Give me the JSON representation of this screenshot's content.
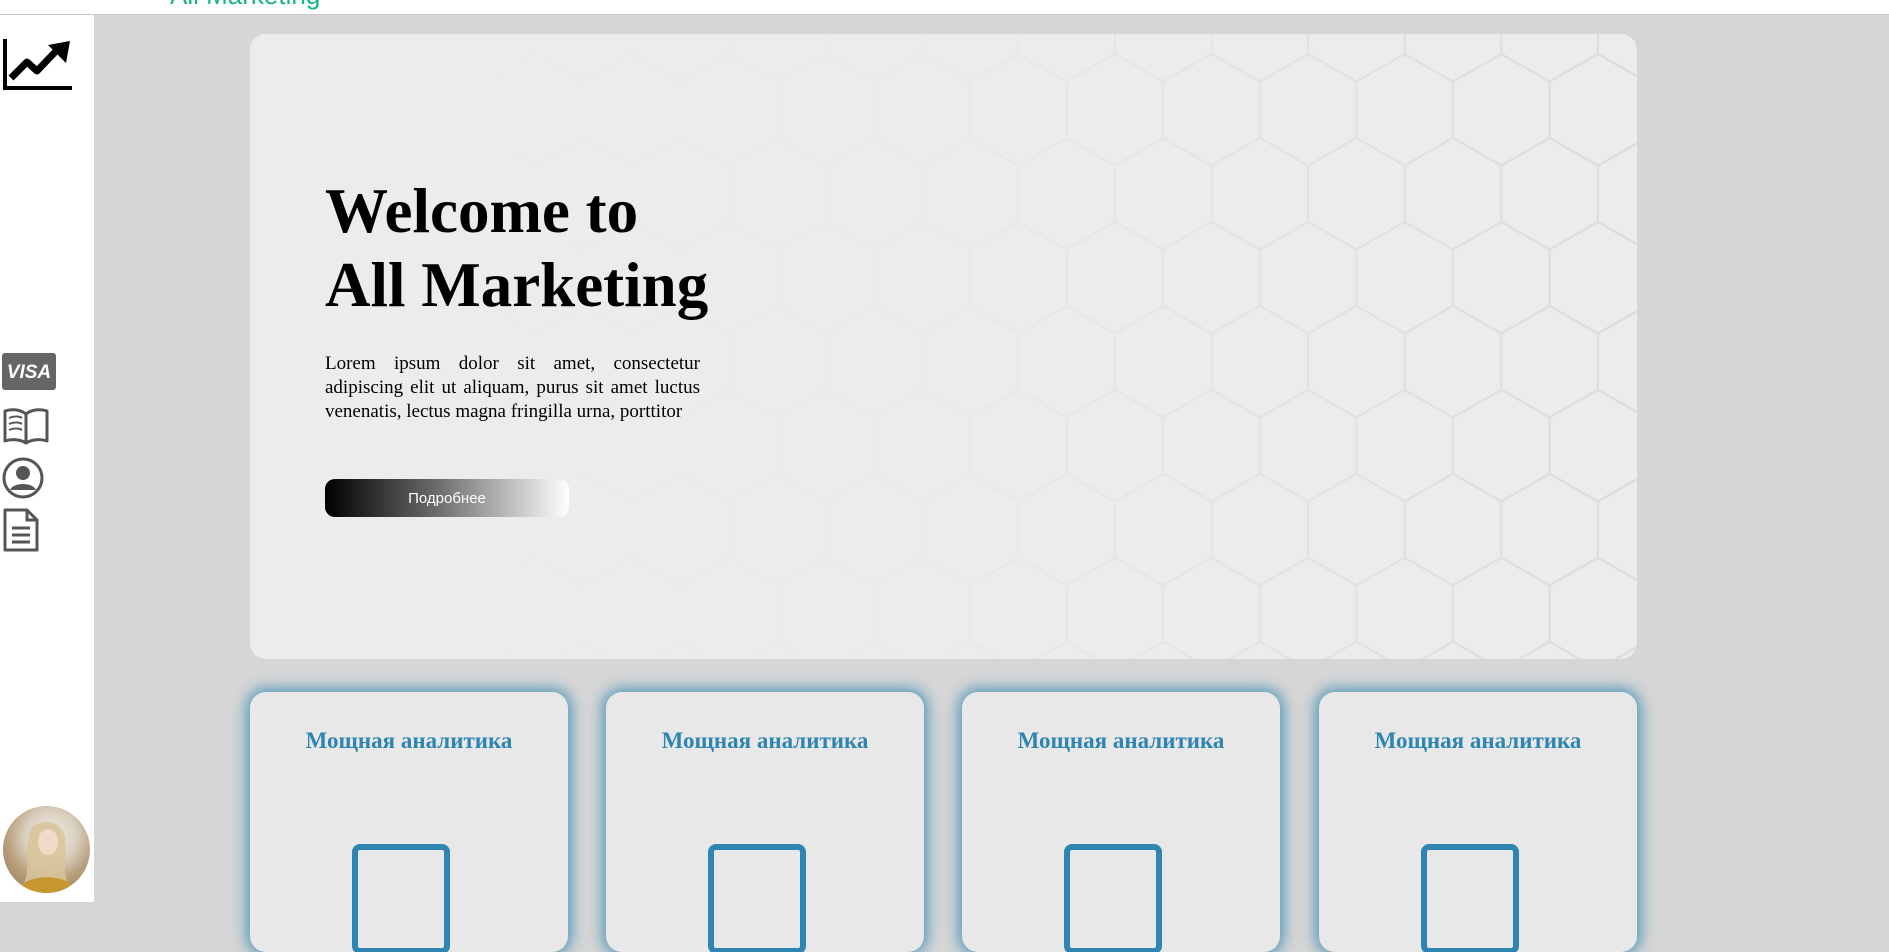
{
  "topbar": {
    "title": "All Marketing"
  },
  "sidebar": {
    "icons": [
      "trending-up-icon",
      "visa-card-icon",
      "book-icon",
      "user-circle-icon",
      "document-icon"
    ],
    "avatar": "user-avatar"
  },
  "hero": {
    "title_line1": "Welcome to",
    "title_line2": "All Marketing",
    "text": "Lorem ipsum dolor sit amet, consectetur adipiscing elit ut aliquam, purus sit amet luctus venenatis, lectus magna fringilla urna, porttitor",
    "button_label": "Подробнее"
  },
  "cards": [
    {
      "title": "Мощная аналитика",
      "icon": "feature-icon"
    },
    {
      "title": "Мощная аналитика",
      "icon": "feature-icon"
    },
    {
      "title": "Мощная аналитика",
      "icon": "feature-icon"
    },
    {
      "title": "Мощная аналитика",
      "icon": "feature-icon"
    }
  ],
  "colors": {
    "background": "#d6d6d6",
    "hero_bg": "#ececec",
    "accent": "#2f85b2",
    "topbar_title": "#19b38a"
  }
}
